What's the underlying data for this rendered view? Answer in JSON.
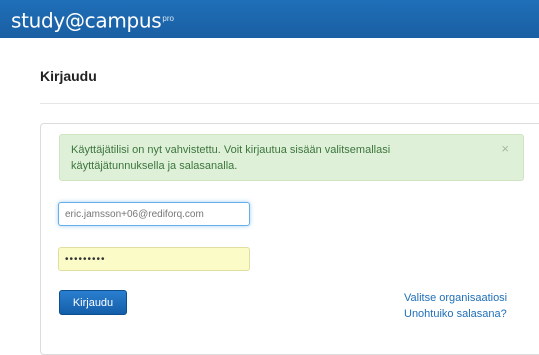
{
  "header": {
    "logo_text": "study@campus",
    "logo_suffix": "pro"
  },
  "page": {
    "title": "Kirjaudu"
  },
  "alert": {
    "message": "Käyttäjätilisi on nyt vahvistettu. Voit kirjautua sisään valitsemallasi käyttäjätunnuksella ja salasanalla.",
    "close_symbol": "×"
  },
  "form": {
    "email_value": "eric.jamsson+06@rediforq.com",
    "password_value": "•••••••••",
    "submit_label": "Kirjaudu"
  },
  "links": {
    "choose_organization": "Valitse organisaatiosi",
    "forgot_password": "Unohtuiko salasana?"
  },
  "colors": {
    "header_bg": "#1a66ad",
    "alert_bg": "#dff0d8",
    "alert_text": "#3c763d",
    "button_bg": "#1b6cc0",
    "link": "#1f6fb8"
  }
}
